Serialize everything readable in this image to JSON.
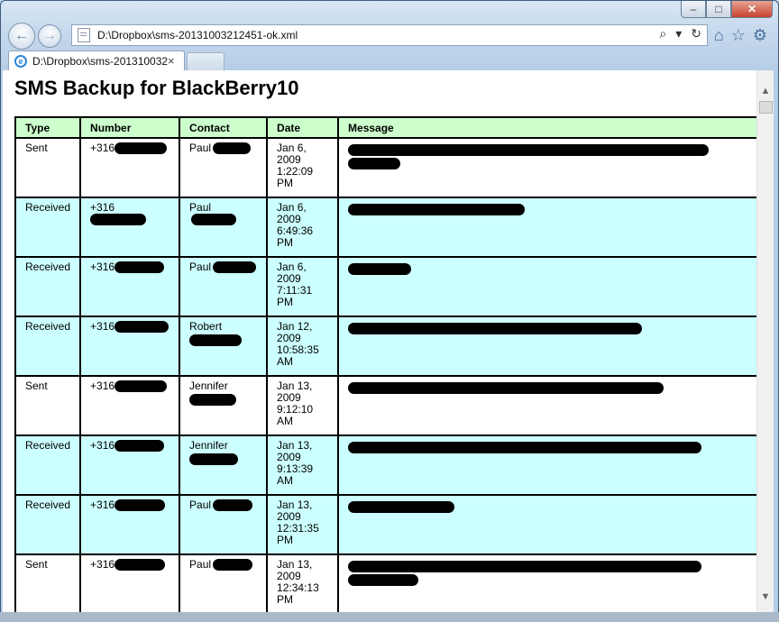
{
  "window": {
    "minimize_label": "–",
    "maximize_label": "□",
    "close_label": "✕"
  },
  "address_bar": {
    "url": "D:\\Dropbox\\sms-20131003212451-ok.xml",
    "search_glyph": "⌕",
    "dropdown_glyph": "▾",
    "refresh_glyph": "↻"
  },
  "tab": {
    "title": "D:\\Dropbox\\sms-201310032...",
    "close_glyph": "×",
    "icon": "ie-icon"
  },
  "nav": {
    "back_glyph": "←",
    "forward_glyph": "→",
    "home_glyph": "⌂",
    "favorites_glyph": "☆",
    "tools_glyph": "⚙"
  },
  "page": {
    "title": "SMS Backup for BlackBerry10",
    "columns": [
      "Type",
      "Number",
      "Contact",
      "Date",
      "Message"
    ],
    "rows": [
      {
        "type": "Sent",
        "number": "+316",
        "contact": "Paul",
        "date": [
          "Jan 6,",
          "2009",
          "1:22:09",
          "PM"
        ]
      },
      {
        "type": "Received",
        "number": "+316",
        "contact": "Paul",
        "date": [
          "Jan 6,",
          "2009",
          "6:49:36",
          "PM"
        ]
      },
      {
        "type": "Received",
        "number": "+316",
        "contact": "Paul",
        "date": [
          "Jan 6,",
          "2009",
          "7:11:31",
          "PM"
        ]
      },
      {
        "type": "Received",
        "number": "+316",
        "contact": "Robert",
        "date": [
          "Jan 12,",
          "2009",
          "10:58:35",
          "AM"
        ]
      },
      {
        "type": "Sent",
        "number": "+316",
        "contact": "Jennifer",
        "date": [
          "Jan 13,",
          "2009",
          "9:12:10",
          "AM"
        ]
      },
      {
        "type": "Received",
        "number": "+316",
        "contact": "Jennifer",
        "date": [
          "Jan 13,",
          "2009",
          "9:13:39",
          "AM"
        ]
      },
      {
        "type": "Received",
        "number": "+316",
        "contact": "Paul",
        "date": [
          "Jan 13,",
          "2009",
          "12:31:35",
          "PM"
        ]
      },
      {
        "type": "Sent",
        "number": "+316",
        "contact": "Paul",
        "date": [
          "Jan 13,",
          "2009",
          "12:34:13",
          "PM"
        ]
      }
    ]
  },
  "scrollbar": {
    "up_glyph": "▲",
    "down_glyph": "▼"
  },
  "colors": {
    "header_bg": "#ccffcc",
    "received_bg": "#ccffff",
    "sent_bg": "#ffffff"
  }
}
